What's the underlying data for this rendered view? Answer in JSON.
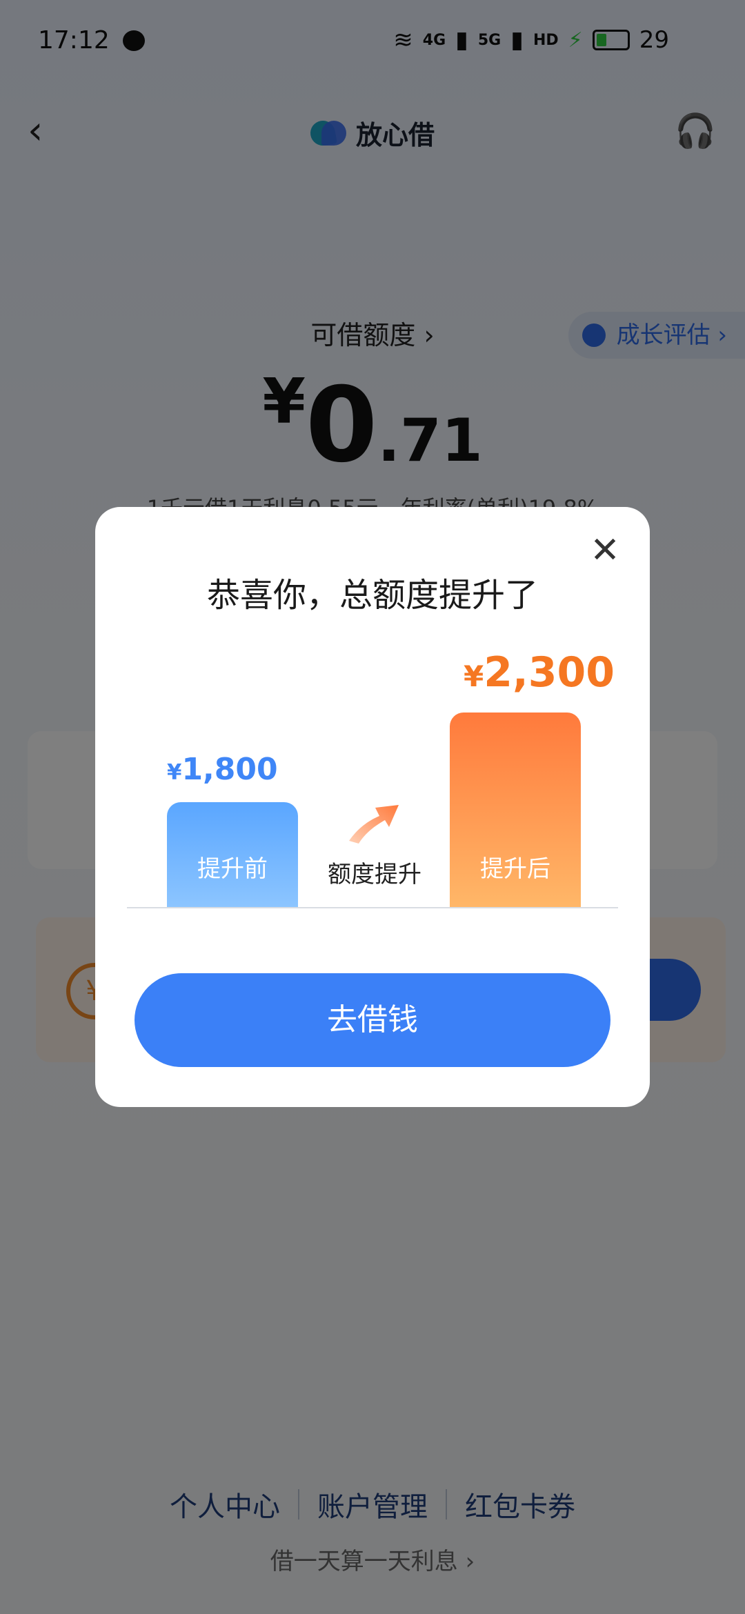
{
  "status_bar": {
    "time": "17:12",
    "network_1": "4G",
    "network_2": "5G",
    "hd": "HD",
    "battery": "29"
  },
  "header": {
    "brand_name": "放心借"
  },
  "main": {
    "growth_label": "成长评估",
    "credit_label": "可借额度",
    "amount_currency": "¥",
    "amount_integer": "0",
    "amount_decimal": ".71",
    "rate_text": "1千元借1天利息0.55元，年利率(单利)19.8%"
  },
  "footer": {
    "links": [
      "个人中心",
      "账户管理",
      "红包卡券"
    ],
    "sub": "借一天算一天利息"
  },
  "dialog": {
    "title": "恭喜你，总额度提升了",
    "before_currency": "¥",
    "before_value": "1,800",
    "before_label": "提升前",
    "after_currency": "¥",
    "after_value": "2,300",
    "after_label": "提升后",
    "middle_label": "额度提升",
    "cta_label": "去借钱"
  },
  "colors": {
    "primary": "#3b80f7",
    "orange": "#f57722",
    "overlay": "rgba(0,0,0,0.5)"
  }
}
